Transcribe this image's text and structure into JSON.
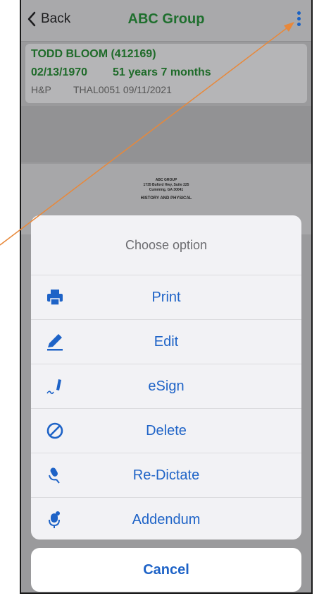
{
  "navbar": {
    "back_label": "Back",
    "title": "ABC Group"
  },
  "patient": {
    "name_id": "TODD BLOOM (412169)",
    "dob": "02/13/1970",
    "age": "51 years 7 months",
    "doc_type": "H&P",
    "doc_ref": "THAL0051 09/11/2021"
  },
  "document_preview": {
    "line1": "ABC GROUP",
    "line2": "1735 Buford Hwy, Suite 225",
    "line3": "Cumming, GA 30041",
    "line4": "HISTORY AND PHYSICAL"
  },
  "action_sheet": {
    "title": "Choose option",
    "options": [
      {
        "label": "Print",
        "icon": "printer-icon"
      },
      {
        "label": "Edit",
        "icon": "pencil-icon"
      },
      {
        "label": "eSign",
        "icon": "signature-pen-icon"
      },
      {
        "label": "Delete",
        "icon": "prohibited-icon"
      },
      {
        "label": "Re-Dictate",
        "icon": "dictate-mic-icon"
      },
      {
        "label": "Addendum",
        "icon": "addendum-mic-icon"
      }
    ],
    "cancel_label": "Cancel"
  },
  "colors": {
    "accent_blue": "#1e63c7",
    "title_green": "#1f6f2e",
    "annotation_arrow": "#e8883a"
  }
}
